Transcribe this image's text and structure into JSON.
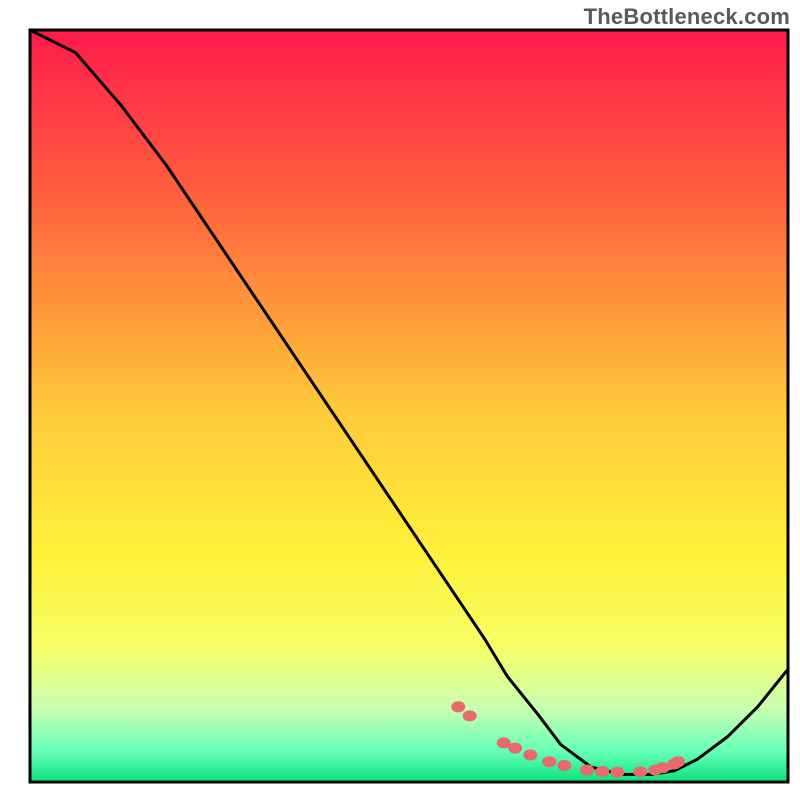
{
  "watermark": "TheBottleneck.com",
  "chart_data": {
    "type": "line",
    "title": "",
    "xlabel": "",
    "ylabel": "",
    "xlim": [
      0,
      100
    ],
    "ylim": [
      0,
      100
    ],
    "grid": false,
    "legend": false,
    "gradient_stops": [
      {
        "offset": 0,
        "color": "#ff1a4b"
      },
      {
        "offset": 25,
        "color": "#ff6a3c"
      },
      {
        "offset": 50,
        "color": "#ffc83a"
      },
      {
        "offset": 70,
        "color": "#fff23a"
      },
      {
        "offset": 82,
        "color": "#f6ff66"
      },
      {
        "offset": 90,
        "color": "#caffb0"
      },
      {
        "offset": 96,
        "color": "#66ffb8"
      },
      {
        "offset": 100,
        "color": "#08e27a"
      }
    ],
    "series": [
      {
        "name": "curve",
        "color": "#000000",
        "x": [
          0,
          6,
          12,
          18,
          24,
          30,
          36,
          42,
          48,
          54,
          60,
          63,
          67,
          70,
          74,
          78,
          82,
          85,
          88,
          92,
          96,
          100
        ],
        "y": [
          100,
          97,
          90,
          82,
          73,
          64,
          55,
          46,
          37,
          28,
          19,
          14,
          9,
          5,
          2,
          1,
          1,
          1.5,
          3,
          6,
          10,
          15
        ]
      }
    ],
    "markers": {
      "name": "dots",
      "color": "#e86a6a",
      "x": [
        56.5,
        58,
        62.5,
        64,
        66,
        68.5,
        70.5,
        73.5,
        75.5,
        77.5,
        80.5,
        82.5,
        83.5,
        85,
        85.5
      ],
      "y": [
        10,
        8.8,
        5.2,
        4.5,
        3.6,
        2.7,
        2.2,
        1.6,
        1.4,
        1.3,
        1.35,
        1.6,
        1.9,
        2.4,
        2.7
      ]
    }
  }
}
